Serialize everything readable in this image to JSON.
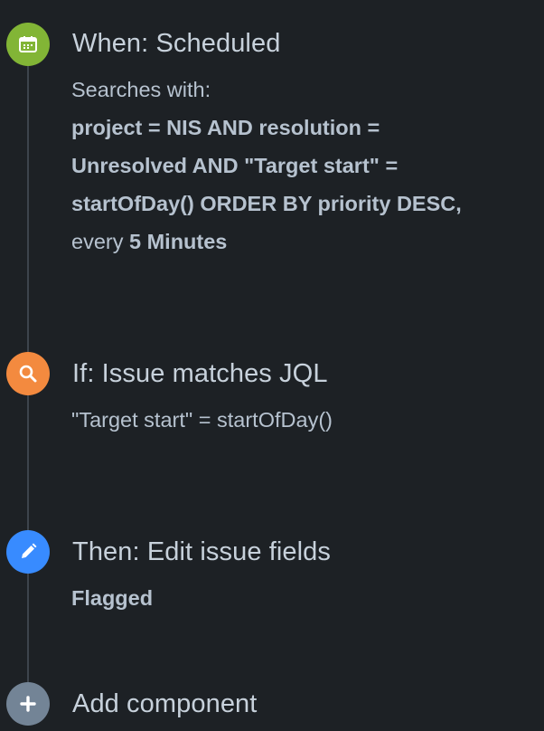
{
  "steps": {
    "trigger": {
      "icon": "calendar-icon",
      "color": "#82b536",
      "title": "When: Scheduled",
      "searches_label": "Searches with:",
      "jql_line1": "project = NIS AND resolution =",
      "jql_line2": "Unresolved AND \"Target start\" =",
      "jql_line3": "startOfDay() ORDER BY priority DESC,",
      "every_label": "every",
      "interval": "5 Minutes"
    },
    "condition": {
      "icon": "search-icon",
      "color": "#f38a3f",
      "title": "If: Issue matches JQL",
      "jql": "\"Target start\" = startOfDay()"
    },
    "action": {
      "icon": "pencil-icon",
      "color": "#388bff",
      "title": "Then: Edit issue fields",
      "field": "Flagged"
    },
    "add": {
      "icon": "plus-icon",
      "color": "#738496",
      "title": "Add component"
    }
  }
}
